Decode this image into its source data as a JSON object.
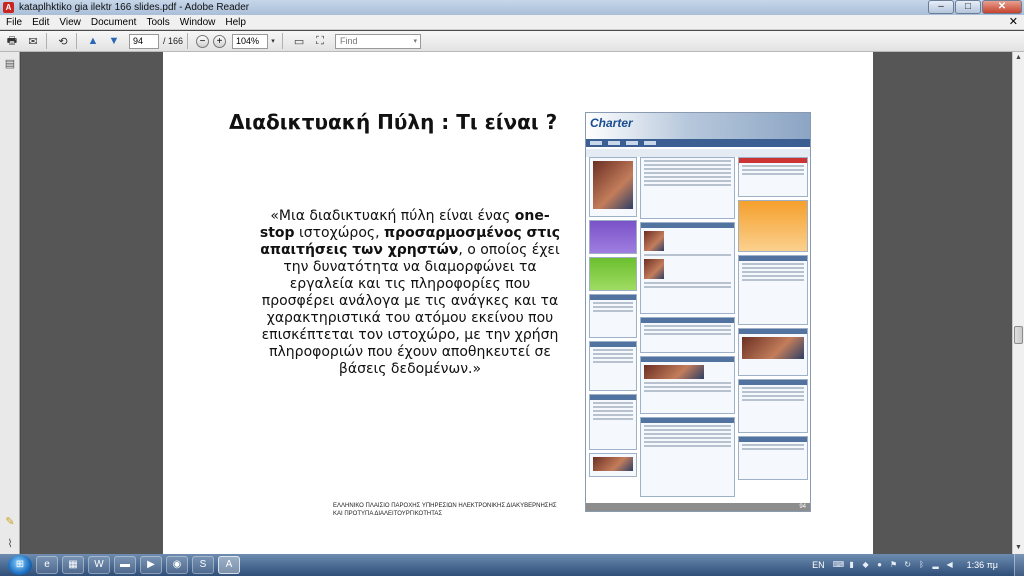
{
  "window": {
    "title": "kataplhktiko gia ilektr 166 slides.pdf - Adobe Reader"
  },
  "menu": {
    "items": [
      "File",
      "Edit",
      "View",
      "Document",
      "Tools",
      "Window",
      "Help"
    ]
  },
  "toolbar": {
    "page_current": "94",
    "page_total": "/ 166",
    "zoom": "104%",
    "find_placeholder": "Find"
  },
  "slide": {
    "title": "Διαδικτυακή Πύλη : Τι είναι ?",
    "quote_part1": "«Μια διαδικτυακή πύλη είναι ένας ",
    "quote_bold1": "one-stop",
    "quote_part2": " ιστοχώρος, ",
    "quote_bold2": "προσαρμοσμένος στις απαιτήσεις των χρηστών",
    "quote_part3": ", ο οποίος έχει την δυνατότητα να διαμορφώνει τα εργαλεία και τις πληροφορίες που προσφέρει ανάλογα με τις ανάγκες και τα χαρακτηριστικά του ατόμου εκείνου που επισκέπτεται τον ιστοχώρο, με την χρήση πληροφοριών που έχουν αποθηκευτεί σε βάσεις δεδομένων.»",
    "footer_line1": "ΕΛΛΗΝΙΚΟ ΠΛΑΙΣΙΟ ΠΑΡΟΧΗΣ ΥΠΗΡΕΣΙΩΝ ΗΛΕΚΤΡΟΝΙΚΗΣ ΔΙΑΚΥΒΕΡΝΗΣΗΣ",
    "footer_line2": "ΚΑΙ ΠΡΟΤΥΠΑ ΔΙΑΛΕΙΤΟΥΡΓΙΚΟΤΗΤΑΣ",
    "screenshot_logo": "Charter",
    "slide_number": "94"
  },
  "taskbar": {
    "language": "EN",
    "clock": "1:36 πμ"
  },
  "colors": {
    "pdf_background": "#565656",
    "taskbar": "#2f4e78",
    "portal_nav": "#3c5f93"
  }
}
